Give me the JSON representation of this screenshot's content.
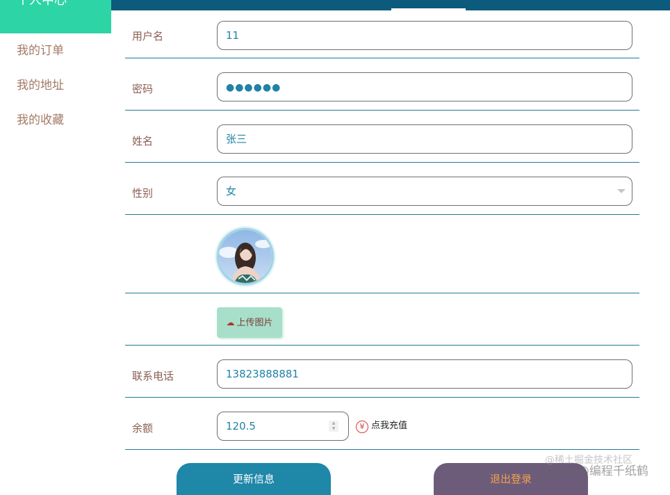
{
  "sidebar": {
    "active_label": "个人中心",
    "items": [
      {
        "label": "我的订单"
      },
      {
        "label": "我的地址"
      },
      {
        "label": "我的收藏"
      }
    ]
  },
  "form": {
    "username": {
      "label": "用户名",
      "value": "11"
    },
    "password": {
      "label": "密码",
      "value": "●●●●●●"
    },
    "name": {
      "label": "姓名",
      "value": "张三"
    },
    "gender": {
      "label": "性别",
      "value": "女"
    },
    "upload_button_label": "上传图片",
    "phone": {
      "label": "联系电话",
      "value": "13823888881"
    },
    "balance": {
      "label": "余额",
      "value": "120.5"
    },
    "recharge_label": "点我充值",
    "recharge_icon": "¥"
  },
  "actions": {
    "update_label": "更新信息",
    "logout_label": "退出登录"
  },
  "watermark": {
    "line1": "@稀土掘金技术社区",
    "line2": "CSDN @编程千纸鹤"
  },
  "colors": {
    "topbar": "#0c5a7c",
    "sidebar_active": "#2dd4a6",
    "update_button": "#1f87a8",
    "logout_button": "#6d5b7a"
  }
}
